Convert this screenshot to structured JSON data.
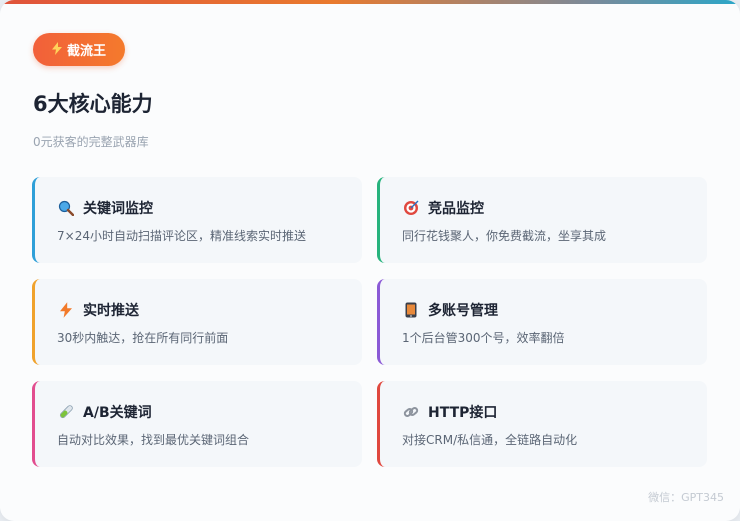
{
  "badge": {
    "label": "截流王",
    "icon": "lightning-icon"
  },
  "title": "6大核心能力",
  "subtitle": "0元获客的完整武器库",
  "features": [
    {
      "name": "关键词监控",
      "desc": "7×24小时自动扫描评论区，精准线索实时推送",
      "icon": "magnifier-icon",
      "accent": "#2e9fd8"
    },
    {
      "name": "竞品监控",
      "desc": "同行花钱聚人，你免费截流，坐享其成",
      "icon": "target-icon",
      "accent": "#27b37d"
    },
    {
      "name": "实时推送",
      "desc": "30秒内触达，抢在所有同行前面",
      "icon": "lightning-icon",
      "accent": "#f0a22c"
    },
    {
      "name": "多账号管理",
      "desc": "1个后台管300个号，效率翻倍",
      "icon": "phone-icon",
      "accent": "#8b5ad6"
    },
    {
      "name": "A/B关键词",
      "desc": "自动对比效果，找到最优关键词组合",
      "icon": "test-tube-icon",
      "accent": "#e24d8f"
    },
    {
      "name": "HTTP接口",
      "desc": "对接CRM/私信通，全链路自动化",
      "icon": "link-icon",
      "accent": "#e0483f"
    }
  ],
  "watermark": "微信：GPT345"
}
